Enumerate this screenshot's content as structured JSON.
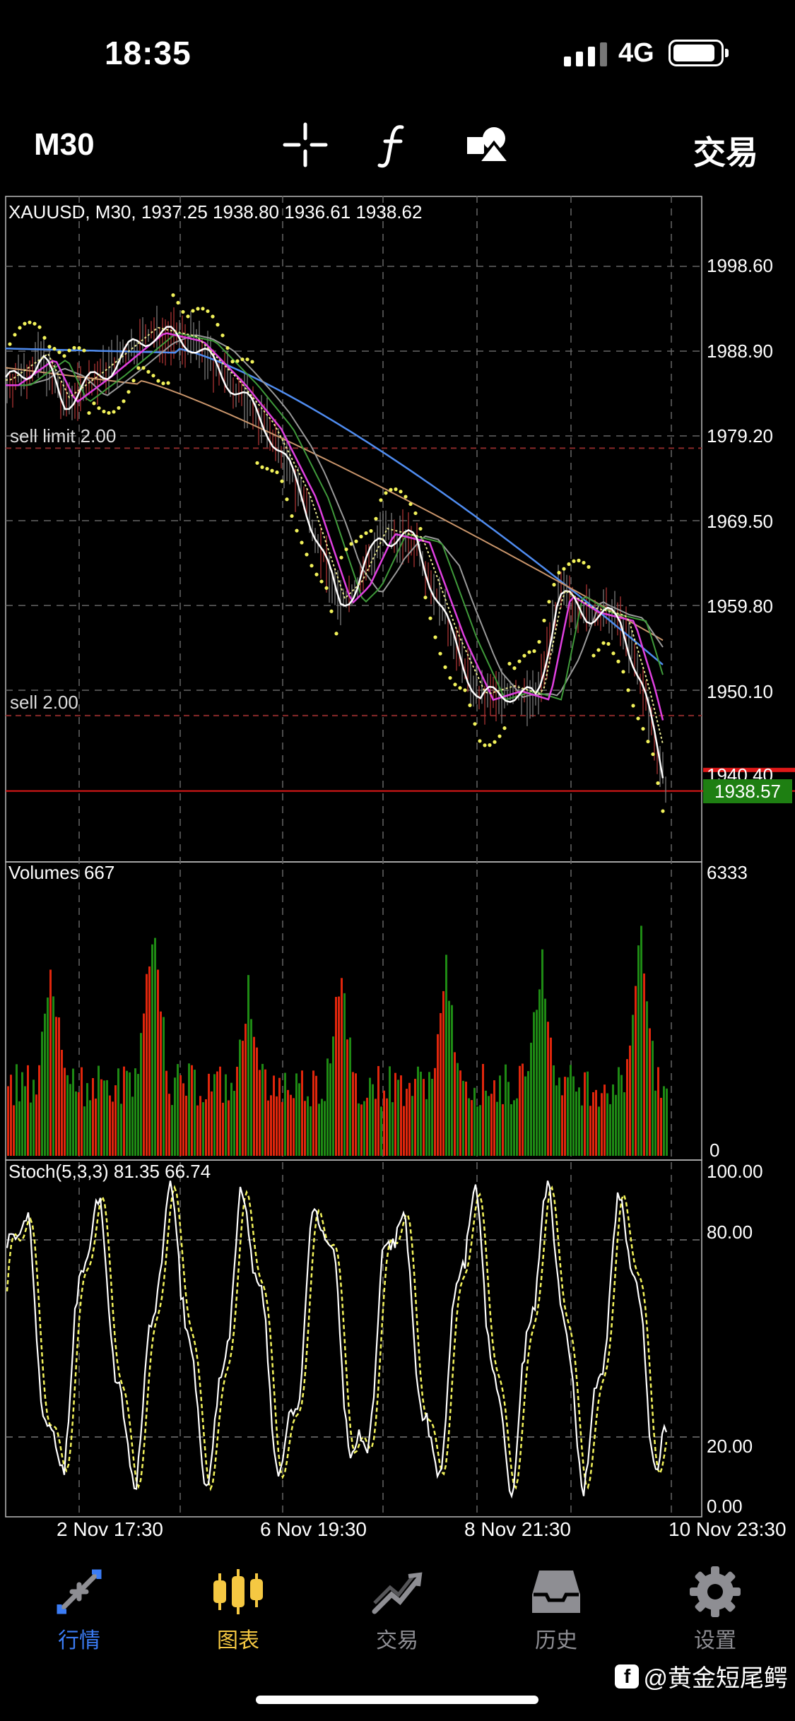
{
  "status": {
    "time": "18:35",
    "network": "4G"
  },
  "toolbar": {
    "timeframe": "M30",
    "trade_label": "交易",
    "icons": [
      "crosshair-icon",
      "function-icon",
      "objects-icon"
    ]
  },
  "chart": {
    "header": "XAUUSD, M30, 1937.25 1938.80 1936.61 1938.62",
    "price_ticks": [
      "1998.60",
      "1988.90",
      "1979.20",
      "1969.50",
      "1959.80",
      "1950.10",
      "1940.40"
    ],
    "current_price": "1938.57",
    "orders": [
      {
        "label": "sell limit 2.00",
        "price": 1977.8
      },
      {
        "label": "sell 2.00",
        "price": 1947.2
      }
    ],
    "volumes_label": "Volumes 667",
    "volume_max": "6333",
    "volume_min": "0",
    "stoch_label": "Stoch(5,3,3) 81.35 66.74",
    "stoch_ticks": [
      "100.00",
      "80.00",
      "20.00",
      "0.00"
    ],
    "time_labels": [
      "2 Nov 17:30",
      "6 Nov 19:30",
      "8 Nov 21:30",
      "10 Nov 23:30"
    ],
    "colors": {
      "bull_volume": "#1e8a14",
      "bear_volume": "#e0260c",
      "ma_blue": "#4f8cf0",
      "ma_tan": "#c9956b",
      "ma_magenta": "#e040e0",
      "ma_green": "#3f9a3a",
      "ma_gray": "#9a9a9a",
      "psar_yellow": "#f2f25a",
      "current_price_tag": "#1e7f12",
      "bid_line": "#e01818"
    }
  },
  "tabs": [
    {
      "label": "行情",
      "icon": "quotes-arrows-icon",
      "color": "#3b7cf5",
      "active": false
    },
    {
      "label": "图表",
      "icon": "candles-chart-icon",
      "color": "#f5c842",
      "active": true
    },
    {
      "label": "交易",
      "icon": "trade-line-icon",
      "color": "#8e8e93",
      "active": false
    },
    {
      "label": "历史",
      "icon": "history-inbox-icon",
      "color": "#8e8e93",
      "active": false
    },
    {
      "label": "设置",
      "icon": "settings-gear-icon",
      "color": "#8e8e93",
      "active": false
    }
  ],
  "watermark": "@黄金短尾鳄"
}
